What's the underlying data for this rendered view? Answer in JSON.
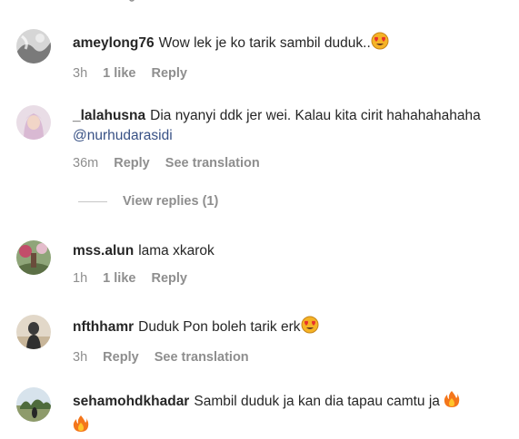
{
  "comments": [
    {
      "username": "ameylong76",
      "text": "Wow lek je ko tarik sambil duduk..",
      "emoji": "heart-eyes-emoji",
      "time": "3h",
      "likes": "1 like",
      "reply": "Reply"
    },
    {
      "username": "_lalahusna",
      "text": "Dia nyanyi ddk jer wei. Kalau kita cirit hahahahahaha",
      "mention": "@nurhudarasidi",
      "time": "36m",
      "reply": "Reply",
      "translate": "See translation",
      "view_replies": "View replies (1)"
    },
    {
      "username": "mss.alun",
      "text": "lama xkarok",
      "time": "1h",
      "likes": "1 like",
      "reply": "Reply"
    },
    {
      "username": "nfthhamr",
      "text": "Duduk Pon boleh tarik erk",
      "emoji": "heart-eyes-emoji",
      "time": "3h",
      "reply": "Reply",
      "translate": "See translation"
    },
    {
      "username": "sehamohdkhadar",
      "text": "Sambil duduk ja kan dia tapau camtu ja",
      "emoji": "fire-emoji",
      "time": "",
      "reply": ""
    }
  ],
  "colors": {
    "text": "#262626",
    "secondary": "#8e8e8e",
    "mention": "#385185"
  }
}
